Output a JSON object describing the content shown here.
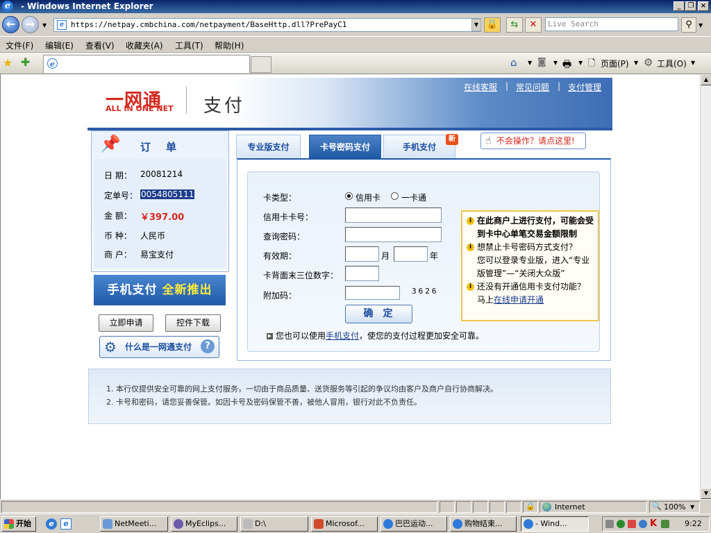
{
  "window": {
    "title": "- Windows Internet Explorer"
  },
  "address": {
    "url": "https://netpay.cmbchina.com/netpayment/BaseHttp.dll?PrePayC1",
    "search_placeholder": "Live Search"
  },
  "menu": [
    "文件(F)",
    "编辑(E)",
    "查看(V)",
    "收藏夹(A)",
    "工具(T)",
    "帮助(H)"
  ],
  "toolbar": {
    "page_label": "页面(P)",
    "tools_label": "工具(O)"
  },
  "header": {
    "logo_text": "一网通",
    "logo_sub": "ALL IN ONE NET",
    "title": "支付",
    "links": [
      "在线客服",
      "常见问题",
      "支付管理"
    ]
  },
  "order": {
    "title": "订单",
    "rows": [
      {
        "label": "日  期：",
        "value": "20081214"
      },
      {
        "label": "定单号：",
        "value": "0054805111"
      },
      {
        "label": "金  额：",
        "value": "￥397.00"
      },
      {
        "label": "币  种：",
        "value": "人民币"
      },
      {
        "label": "商  户：",
        "value": "易宝支付"
      }
    ]
  },
  "promo": {
    "mobile_text": "手机支付",
    "new_text": "全新推出"
  },
  "buttons": {
    "apply": "立即申请",
    "download": "控件下载",
    "what_is": "什么是一网通支付"
  },
  "tabs": {
    "pro": "专业版支付",
    "card": "卡号密码支付",
    "mobile": "手机支付",
    "new_badge": "新"
  },
  "help": {
    "label": "不会操作？请点这里!"
  },
  "form": {
    "card_type_label": "卡类型：",
    "credit_card": "信用卡",
    "one_card": "一卡通",
    "card_no_label": "信用卡卡号：",
    "password_label": "查询密码：",
    "expiry_label": "有效期：",
    "month": "月",
    "year": "年",
    "cvv_label": "卡背面末三位数字：",
    "captcha_label": "附加码：",
    "captcha_code": "3626",
    "confirm": "确定",
    "tip_prefix": "您也可以使用",
    "tip_link": "手机支付",
    "tip_suffix": "，使您的支付过程更加安全可靠。"
  },
  "info": {
    "item1": "在此商户上进行支付，可能会受到卡中心单笔交易金额限制",
    "item2": "想禁止卡号密码方式支付？",
    "item2_detail": "您可以登录专业版，进入“专业版管理”—“关闭大众版”",
    "item3": "还没有开通信用卡支付功能？",
    "item3_prefix": "马上",
    "item3_link": "在线申请开通"
  },
  "notice": [
    "1.  本行仅提供安全可靠的网上支付服务，一切由于商品质量、送货服务等引起的争议均由客户及商户自行协商解决。",
    "2.  卡号和密码，请您妥善保管。如因卡号及密码保管不善，被他人冒用，银行对此不负责任。"
  ],
  "status": {
    "zone": "Internet",
    "zoom": "100%"
  },
  "taskbar": {
    "start": "开始",
    "items": [
      "NetMeeti...",
      "MyEclips...",
      "D:\\",
      "Microsof...",
      "巴巴运动...",
      "购物结束...",
      "- Wind..."
    ],
    "time": "9:22"
  }
}
